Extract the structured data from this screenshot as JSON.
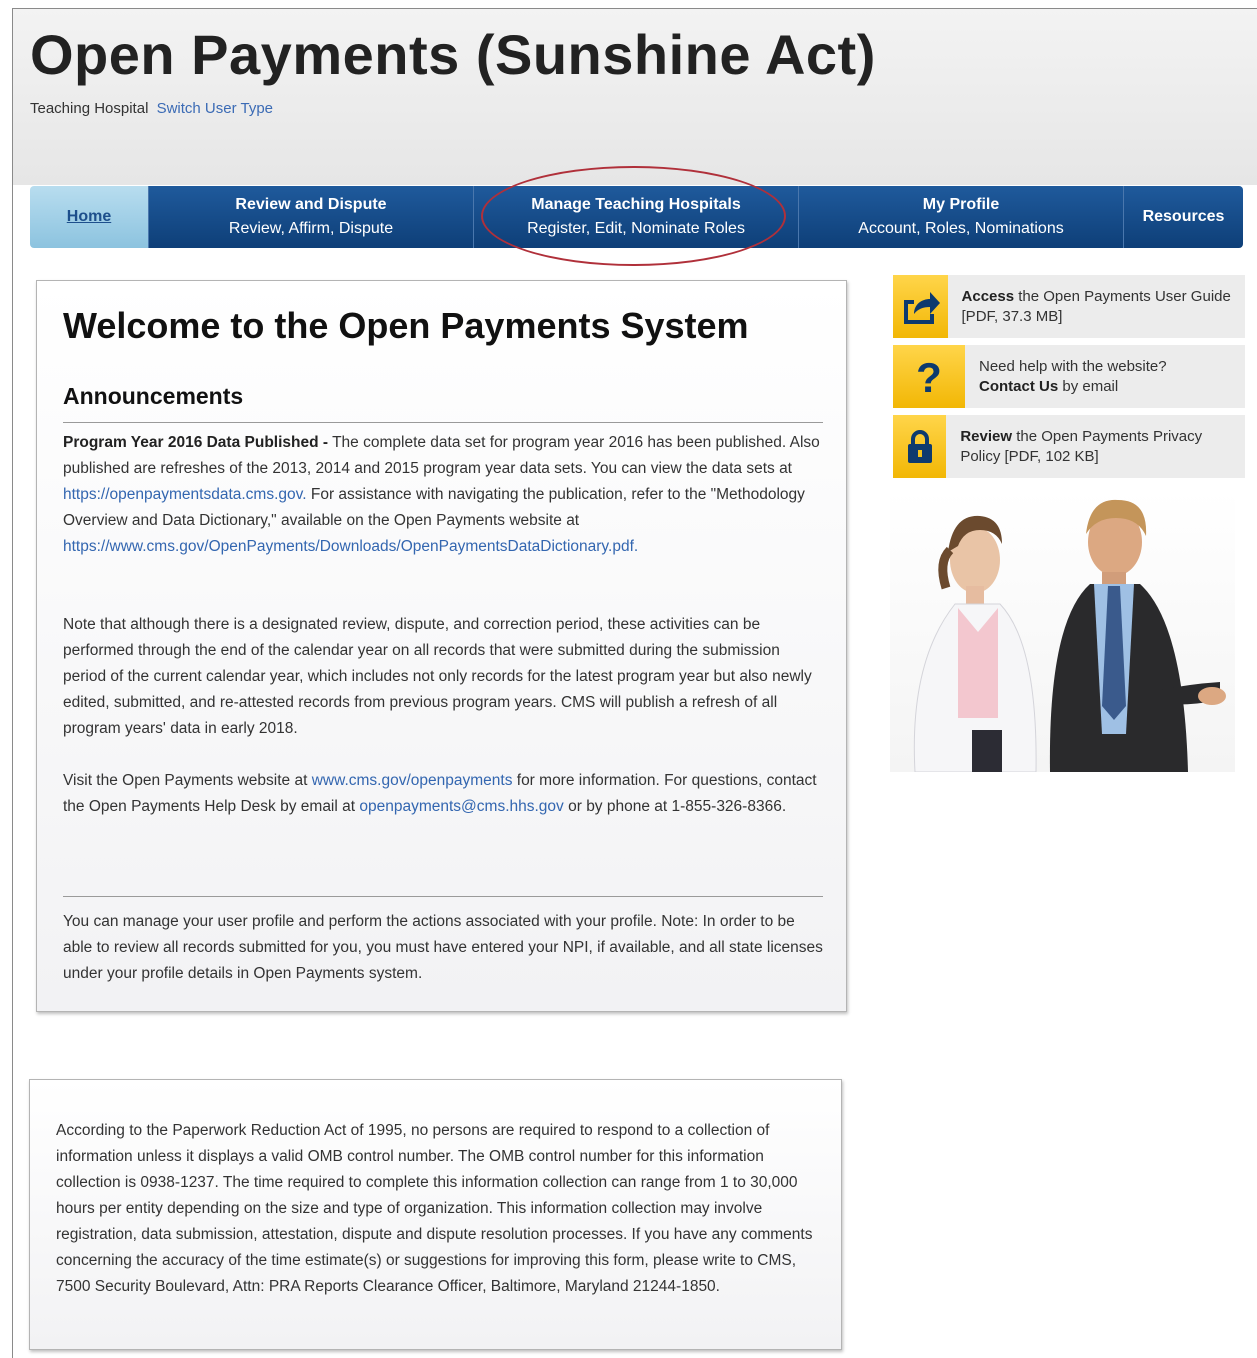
{
  "header": {
    "site_title": "Open Payments (Sunshine Act)",
    "user_type": "Teaching Hospital",
    "switch_user_type": "Switch User Type"
  },
  "nav": {
    "home": "Home",
    "items": [
      {
        "title": "Review and Dispute",
        "subtitle": "Review, Affirm, Dispute"
      },
      {
        "title": "Manage Teaching Hospitals",
        "subtitle": "Register, Edit, Nominate Roles"
      },
      {
        "title": "My Profile",
        "subtitle": "Account, Roles, Nominations"
      }
    ],
    "resources": "Resources"
  },
  "welcome": {
    "title": "Welcome to the Open Payments System",
    "announcements_heading": "Announcements",
    "ann1_bold": "Program Year 2016 Data Published -",
    "ann1_text_a": " The complete data set for program year 2016 has been published. Also published are refreshes of the 2013, 2014 and 2015 program year data sets. You can view the data sets at ",
    "ann1_link1": "https://openpaymentsdata.cms.gov.",
    "ann1_text_b": " For assistance with navigating the publication, refer to the \"Methodology Overview and Data Dictionary,\" available on the Open Payments website at ",
    "ann1_link2": "https://www.cms.gov/OpenPayments/Downloads/OpenPaymentsDataDictionary.pdf.",
    "ann2": "Note that although there is a designated review, dispute, and correction period, these activities can be performed through the end of the calendar year on all records that were submitted during the submission period of the current calendar year, which includes not only records for the latest program year but also newly edited, submitted, and re-attested records from previous program years. CMS will publish a refresh of all program years' data in early 2018.",
    "ann3_text_a": "Visit the Open Payments website at ",
    "ann3_link1": "www.cms.gov/openpayments",
    "ann3_text_b": " for more information. For questions, contact the Open Payments Help Desk by email at ",
    "ann3_link2": "openpayments@cms.hhs.gov",
    "ann3_text_c": " or by phone at 1-855-326-8366.",
    "profile_note": "You can manage your user profile and perform the actions associated with your profile. Note: In order to be able to review all records submitted for you, you must have entered your NPI, if available, and all state licenses under your profile details in Open Payments system."
  },
  "pra": {
    "text": "According to the Paperwork Reduction Act of 1995, no persons are required to respond to a collection of information unless it displays a valid OMB control number. The OMB control number for this information collection is 0938-1237. The time required to complete this information collection can range from 1 to 30,000 hours per entity depending on the size and type of organization. This information collection may involve registration, data submission, attestation, dispute and dispute resolution processes. If you have any comments concerning the accuracy of the time estimate(s) or suggestions for improving this form, please write to CMS, 7500 Security Boulevard, Attn: PRA Reports Clearance Officer, Baltimore, Maryland 21244-1850."
  },
  "sidebar": {
    "guide_bold": "Access",
    "guide_text": " the Open Payments User Guide [PDF, 37.3 MB]",
    "help_text": "Need help with the website?",
    "help_bold": "Contact Us",
    "help_text2": " by email",
    "privacy_bold": "Review",
    "privacy_text": " the Open Payments Privacy Policy [PDF, 102 KB]"
  },
  "icons": {
    "guide": "share-arrow-icon",
    "help": "question-mark-icon",
    "privacy": "padlock-icon"
  },
  "colors": {
    "nav_blue": "#0e3f78",
    "home_tab": "#8cc3df",
    "link": "#3366b0",
    "icon_yellow": "#f2b705",
    "highlight": "#b0303a"
  }
}
